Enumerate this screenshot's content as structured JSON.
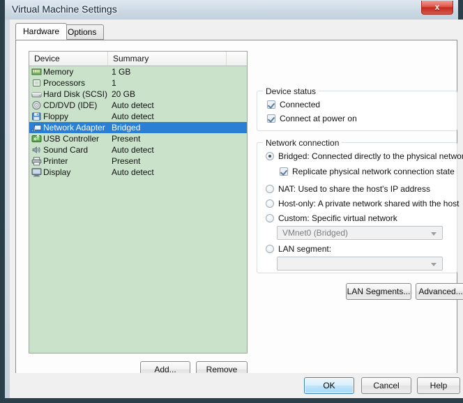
{
  "window": {
    "title": "Virtual Machine Settings",
    "close_label": "x"
  },
  "tabs": [
    {
      "label": "Hardware",
      "active": true
    },
    {
      "label": "Options",
      "active": false
    }
  ],
  "device_list": {
    "columns": [
      "Device",
      "Summary",
      ""
    ],
    "rows": [
      {
        "icon": "memory-icon",
        "name": "Memory",
        "summary": "1 GB",
        "selected": false
      },
      {
        "icon": "processor-icon",
        "name": "Processors",
        "summary": "1",
        "selected": false
      },
      {
        "icon": "hard-disk-icon",
        "name": "Hard Disk (SCSI)",
        "summary": "20 GB",
        "selected": false
      },
      {
        "icon": "cd-dvd-icon",
        "name": "CD/DVD (IDE)",
        "summary": "Auto detect",
        "selected": false
      },
      {
        "icon": "floppy-icon",
        "name": "Floppy",
        "summary": "Auto detect",
        "selected": false
      },
      {
        "icon": "network-adapter-icon",
        "name": "Network Adapter",
        "summary": "Bridged",
        "selected": true
      },
      {
        "icon": "usb-controller-icon",
        "name": "USB Controller",
        "summary": "Present",
        "selected": false
      },
      {
        "icon": "sound-card-icon",
        "name": "Sound Card",
        "summary": "Auto detect",
        "selected": false
      },
      {
        "icon": "printer-icon",
        "name": "Printer",
        "summary": "Present",
        "selected": false
      },
      {
        "icon": "display-icon",
        "name": "Display",
        "summary": "Auto detect",
        "selected": false
      }
    ],
    "add_label": "Add...",
    "remove_label": "Remove"
  },
  "device_status": {
    "title": "Device status",
    "connected": {
      "label": "Connected",
      "checked": true
    },
    "connect_at_power_on": {
      "label": "Connect at power on",
      "checked": true
    }
  },
  "network_connection": {
    "title": "Network connection",
    "bridged": {
      "label": "Bridged: Connected directly to the physical network",
      "selected": true
    },
    "replicate": {
      "label": "Replicate physical network connection state",
      "checked": true
    },
    "nat": {
      "label": "NAT: Used to share the host's IP address",
      "selected": false
    },
    "host_only": {
      "label": "Host-only: A private network shared with the host",
      "selected": false
    },
    "custom": {
      "label": "Custom: Specific virtual network",
      "selected": false
    },
    "custom_value": "VMnet0 (Bridged)",
    "lan_segment": {
      "label": "LAN segment:",
      "selected": false
    },
    "lan_segment_value": "",
    "lan_segments_button": "LAN Segments...",
    "advanced_button": "Advanced..."
  },
  "footer": {
    "ok": "OK",
    "cancel": "Cancel",
    "help": "Help"
  },
  "colors": {
    "selection_blue": "#2a7fd4",
    "list_background": "#c9e2c9",
    "close_red": "#c4291d",
    "ok_focus_blue": "#3c7fb1"
  }
}
